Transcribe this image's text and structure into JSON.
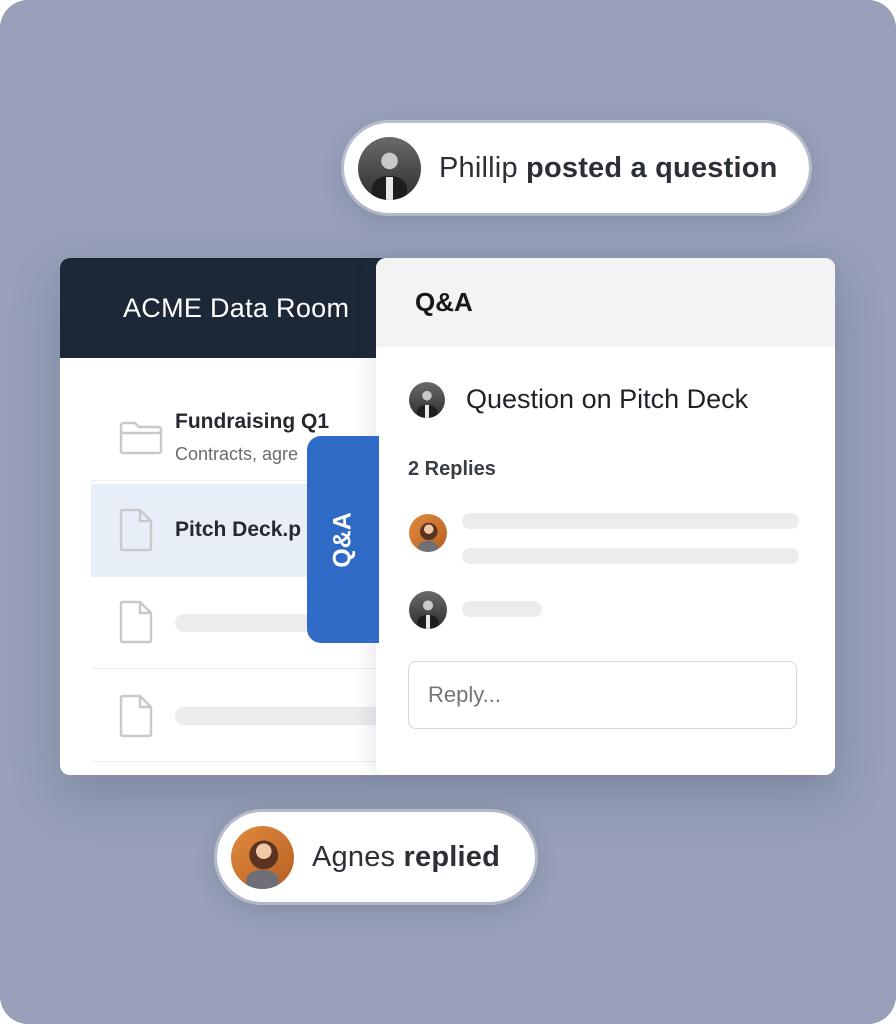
{
  "notifications": {
    "top": {
      "name": "Phillip",
      "action": "posted a question",
      "avatar": "man-avatar"
    },
    "bottom": {
      "name": "Agnes",
      "action": "replied",
      "avatar": "woman-avatar"
    }
  },
  "data_room": {
    "title": "ACME Data Room",
    "files": [
      {
        "icon": "folder-icon",
        "title": "Fundraising Q1",
        "subtitle": "Contracts, agre"
      },
      {
        "icon": "file-icon",
        "title": "Pitch Deck.p",
        "selected": true
      },
      {
        "icon": "file-icon",
        "title": ""
      },
      {
        "icon": "file-icon",
        "title": ""
      }
    ]
  },
  "qa_tab": {
    "label": "Q&A"
  },
  "qa_panel": {
    "title": "Q&A",
    "question": "Question on Pitch Deck",
    "replies_count": "2 Replies",
    "reply_placeholder": "Reply..."
  },
  "colors": {
    "background": "#97a0b8",
    "header_dark": "#1c2838",
    "accent_blue": "#2f6ac6",
    "selected_row": "#e8eef8"
  }
}
